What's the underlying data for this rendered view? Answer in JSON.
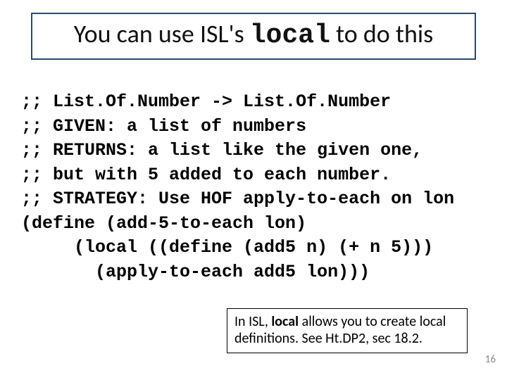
{
  "title": {
    "pre": "You can use ISL's ",
    "mono": "local",
    "post": " to do this"
  },
  "code": {
    "l1": ";; List.Of.Number -> List.Of.Number",
    "l2": ";; GIVEN: a list of numbers",
    "l3": ";; RETURNS: a list like the given one,",
    "l4": ";; but with 5 added to each number.",
    "l5": ";; STRATEGY: Use HOF apply-to-each on lon",
    "l6": "(define (add-5-to-each lon)",
    "l7": "     (local ((define (add5 n) (+ n 5)))",
    "l8": "       (apply-to-each add5 lon)))"
  },
  "note": {
    "t1": "In ISL, ",
    "b1": "local",
    "t2": " allows you to create local definitions. See Ht.DP2, sec 18.2."
  },
  "page": "16"
}
